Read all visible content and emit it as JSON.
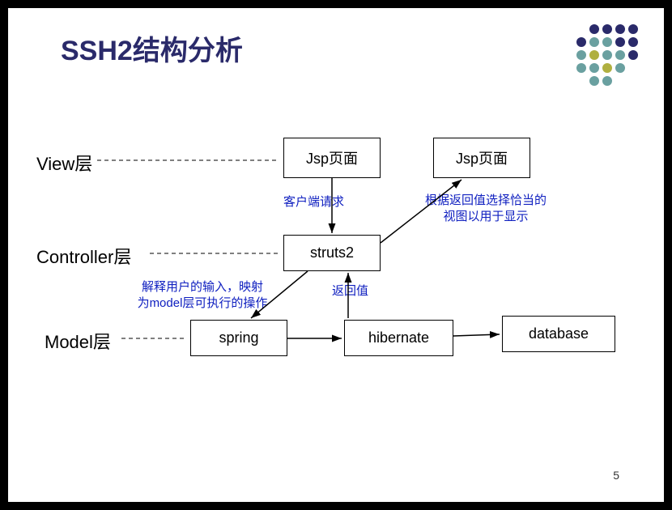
{
  "title": "SSH2结构分析",
  "page_number": "5",
  "layers": {
    "view": "View层",
    "controller": "Controller层",
    "model": "Model层"
  },
  "boxes": {
    "jsp1": "Jsp页面",
    "jsp2": "Jsp页面",
    "struts2": "struts2",
    "spring": "spring",
    "hibernate": "hibernate",
    "database": "database"
  },
  "annotations": {
    "client_request": "客户端请求",
    "select_view": "根据返回值选择恰当的\n视图以用于显示",
    "parse_input": "解释用户的输入，映射\n为model层可执行的操作",
    "return_value": "返回值"
  }
}
